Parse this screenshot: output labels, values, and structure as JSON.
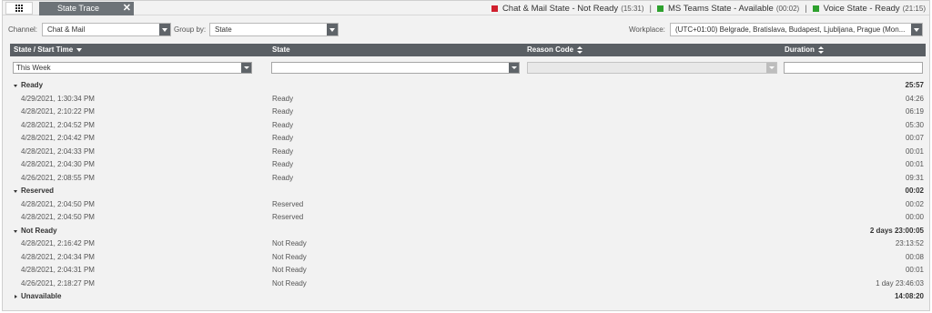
{
  "tab": {
    "title": "State Trace",
    "close": "✕"
  },
  "statuses": [
    {
      "label": "Chat & Mail State - Not Ready",
      "time": "(15:31)",
      "color": "#d0202e"
    },
    {
      "label": "MS Teams State - Available",
      "time": "(00:02)",
      "color": "#2ea12e"
    },
    {
      "label": "Voice State - Ready",
      "time": "(21:15)",
      "color": "#2ea12e"
    }
  ],
  "separator": "|",
  "filters": {
    "channel_label": "Channel:",
    "channel_value": "Chat & Mail",
    "groupby_label": "Group by:",
    "groupby_value": "State",
    "workplace_label": "Workplace:",
    "workplace_value": "(UTC+01:00) Belgrade, Bratislava, Budapest, Ljubljana, Prague (Mon..."
  },
  "columns": {
    "start_time": "State / Start Time",
    "state": "State",
    "reason": "Reason Code",
    "duration": "Duration"
  },
  "column_filters": {
    "start_time": "This Week",
    "state": "",
    "reason": "",
    "duration": ""
  },
  "groups": [
    {
      "name": "Ready",
      "total": "25:57",
      "expanded": true,
      "rows": [
        {
          "time": "4/29/2021, 1:30:34 PM",
          "state": "Ready",
          "duration": "04:26"
        },
        {
          "time": "4/28/2021, 2:10:22 PM",
          "state": "Ready",
          "duration": "06:19"
        },
        {
          "time": "4/28/2021, 2:04:52 PM",
          "state": "Ready",
          "duration": "05:30"
        },
        {
          "time": "4/28/2021, 2:04:42 PM",
          "state": "Ready",
          "duration": "00:07"
        },
        {
          "time": "4/28/2021, 2:04:33 PM",
          "state": "Ready",
          "duration": "00:01"
        },
        {
          "time": "4/28/2021, 2:04:30 PM",
          "state": "Ready",
          "duration": "00:01"
        },
        {
          "time": "4/26/2021, 2:08:55 PM",
          "state": "Ready",
          "duration": "09:31"
        }
      ]
    },
    {
      "name": "Reserved",
      "total": "00:02",
      "expanded": true,
      "rows": [
        {
          "time": "4/28/2021, 2:04:50 PM",
          "state": "Reserved",
          "duration": "00:02"
        },
        {
          "time": "4/28/2021, 2:04:50 PM",
          "state": "Reserved",
          "duration": "00:00"
        }
      ]
    },
    {
      "name": "Not Ready",
      "total": "2 days 23:00:05",
      "expanded": true,
      "rows": [
        {
          "time": "4/28/2021, 2:16:42 PM",
          "state": "Not Ready",
          "duration": "23:13:52"
        },
        {
          "time": "4/28/2021, 2:04:34 PM",
          "state": "Not Ready",
          "duration": "00:08"
        },
        {
          "time": "4/28/2021, 2:04:31 PM",
          "state": "Not Ready",
          "duration": "00:01"
        },
        {
          "time": "4/26/2021, 2:18:27 PM",
          "state": "Not Ready",
          "duration": "1 day 23:46:03"
        }
      ]
    },
    {
      "name": "Unavailable",
      "total": "14:08:20",
      "expanded": false,
      "rows": []
    }
  ]
}
